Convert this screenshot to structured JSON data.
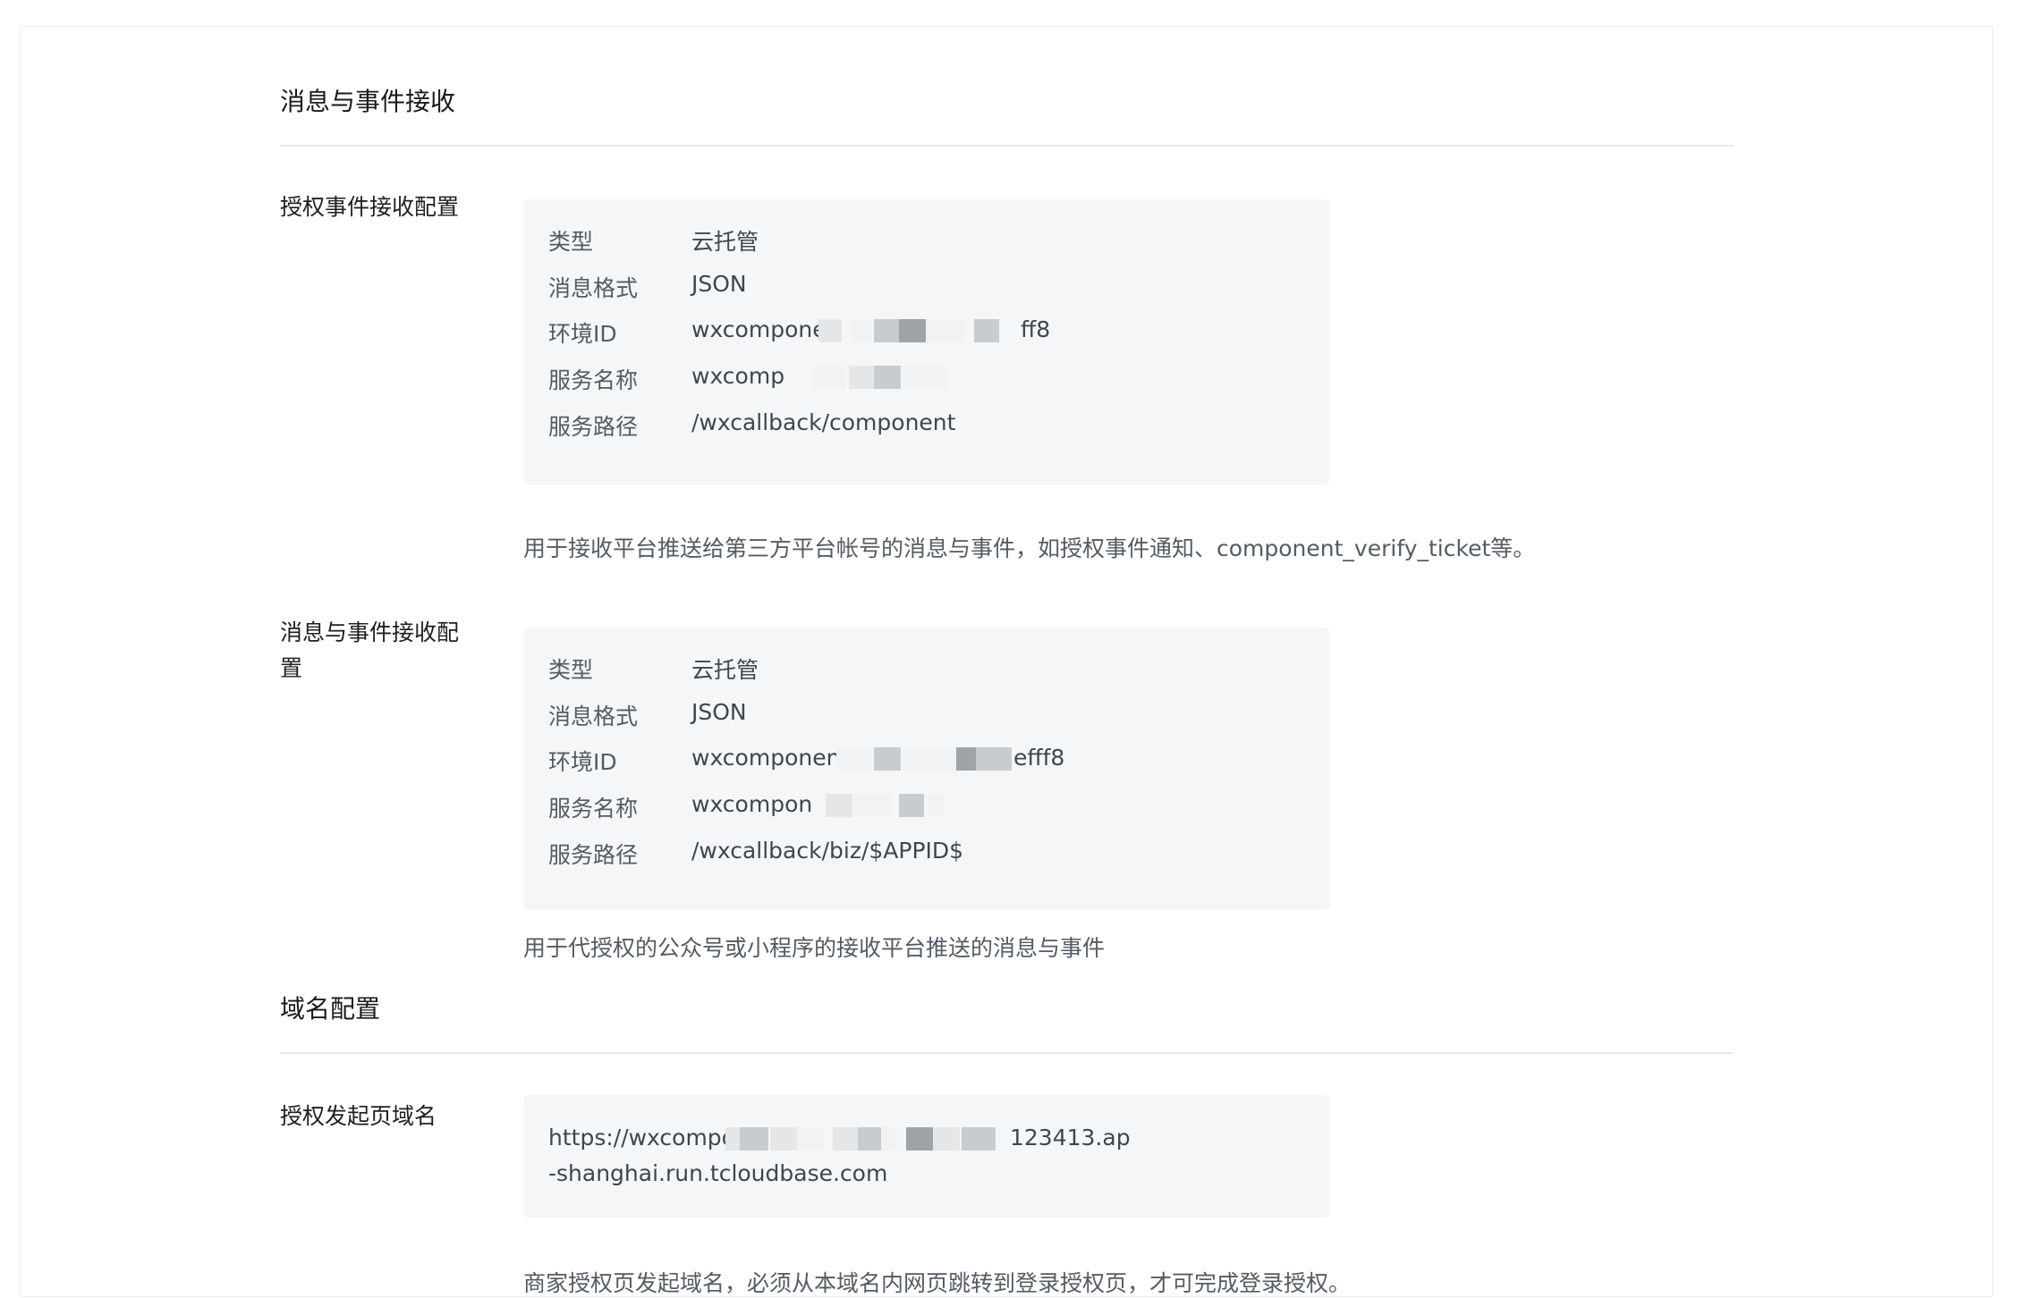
{
  "sections": {
    "messages": {
      "title": "消息与事件接收"
    },
    "domain": {
      "title": "域名配置"
    }
  },
  "auth_event_config": {
    "label": "授权事件接收配置",
    "rows": [
      {
        "key": "类型",
        "value": "云托管"
      },
      {
        "key": "消息格式",
        "value": "JSON"
      },
      {
        "key": "环境ID",
        "value": "wxcomponer",
        "value_tail": "ff8"
      },
      {
        "key": "服务名称",
        "value": "wxcomp"
      },
      {
        "key": "服务路径",
        "value": "/wxcallback/component"
      }
    ],
    "description": "用于接收平台推送给第三方平台帐号的消息与事件，如授权事件通知、component_verify_ticket等。"
  },
  "message_event_config": {
    "label_line1": "消息与事件接收配",
    "label_line2": "置",
    "rows": [
      {
        "key": "类型",
        "value": "云托管"
      },
      {
        "key": "消息格式",
        "value": "JSON"
      },
      {
        "key": "环境ID",
        "value": "wxcomponen",
        "value_tail": "efff8"
      },
      {
        "key": "服务名称",
        "value": "wxcompon"
      },
      {
        "key": "服务路径",
        "value": "/wxcallback/biz/$APPID$"
      }
    ],
    "description": "用于代授权的公众号或小程序的接收平台推送的消息与事件"
  },
  "auth_domain": {
    "label": "授权发起页域名",
    "url_line1_head": "https://wxcompo",
    "url_line1_tail": "123413.ap",
    "url_line2": "-shanghai.run.tcloudbase.com",
    "description": "商家授权页发起域名，必须从本域名内网页跳转到登录授权页，才可完成登录授权。"
  }
}
